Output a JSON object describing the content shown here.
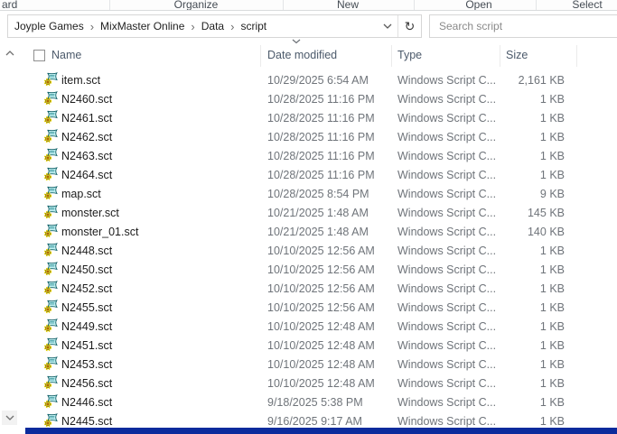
{
  "ribbon": {
    "groups": [
      {
        "label": "ard"
      },
      {
        "label": "Organize"
      },
      {
        "label": "New"
      },
      {
        "label": "Open"
      },
      {
        "label": "Select"
      }
    ]
  },
  "address_bar": {
    "breadcrumb": [
      "Joyple Games",
      "MixMaster Online",
      "Data",
      "script"
    ],
    "separator": "›",
    "dropdown_icon": "chevron-down",
    "refresh_icon": "refresh",
    "refresh_glyph": "↻"
  },
  "search": {
    "placeholder": "Search script"
  },
  "file_list": {
    "columns": {
      "name": "Name",
      "date_modified": "Date modified",
      "type": "Type",
      "size": "Size"
    },
    "sort": {
      "column": "Date modified",
      "direction": "descending"
    },
    "type_label": "Windows Script C...",
    "rows": [
      {
        "name": "item.sct",
        "date_modified": "10/29/2025 6:54 AM",
        "type": "Windows Script C...",
        "size": "2,161 KB"
      },
      {
        "name": "N2460.sct",
        "date_modified": "10/28/2025 11:16 PM",
        "type": "Windows Script C...",
        "size": "1 KB"
      },
      {
        "name": "N2461.sct",
        "date_modified": "10/28/2025 11:16 PM",
        "type": "Windows Script C...",
        "size": "1 KB"
      },
      {
        "name": "N2462.sct",
        "date_modified": "10/28/2025 11:16 PM",
        "type": "Windows Script C...",
        "size": "1 KB"
      },
      {
        "name": "N2463.sct",
        "date_modified": "10/28/2025 11:16 PM",
        "type": "Windows Script C...",
        "size": "1 KB"
      },
      {
        "name": "N2464.sct",
        "date_modified": "10/28/2025 11:16 PM",
        "type": "Windows Script C...",
        "size": "1 KB"
      },
      {
        "name": "map.sct",
        "date_modified": "10/28/2025 8:54 PM",
        "type": "Windows Script C...",
        "size": "9 KB"
      },
      {
        "name": "monster.sct",
        "date_modified": "10/21/2025 1:48 AM",
        "type": "Windows Script C...",
        "size": "145 KB"
      },
      {
        "name": "monster_01.sct",
        "date_modified": "10/21/2025 1:48 AM",
        "type": "Windows Script C...",
        "size": "140 KB"
      },
      {
        "name": "N2448.sct",
        "date_modified": "10/10/2025 12:56 AM",
        "type": "Windows Script C...",
        "size": "1 KB"
      },
      {
        "name": "N2450.sct",
        "date_modified": "10/10/2025 12:56 AM",
        "type": "Windows Script C...",
        "size": "1 KB"
      },
      {
        "name": "N2452.sct",
        "date_modified": "10/10/2025 12:56 AM",
        "type": "Windows Script C...",
        "size": "1 KB"
      },
      {
        "name": "N2455.sct",
        "date_modified": "10/10/2025 12:56 AM",
        "type": "Windows Script C...",
        "size": "1 KB"
      },
      {
        "name": "N2449.sct",
        "date_modified": "10/10/2025 12:48 AM",
        "type": "Windows Script C...",
        "size": "1 KB"
      },
      {
        "name": "N2451.sct",
        "date_modified": "10/10/2025 12:48 AM",
        "type": "Windows Script C...",
        "size": "1 KB"
      },
      {
        "name": "N2453.sct",
        "date_modified": "10/10/2025 12:48 AM",
        "type": "Windows Script C...",
        "size": "1 KB"
      },
      {
        "name": "N2456.sct",
        "date_modified": "10/10/2025 12:48 AM",
        "type": "Windows Script C...",
        "size": "1 KB"
      },
      {
        "name": "N2446.sct",
        "date_modified": "9/18/2025 5:38 PM",
        "type": "Windows Script C...",
        "size": "1 KB"
      },
      {
        "name": "N2445.sct",
        "date_modified": "9/16/2025 9:17 AM",
        "type": "Windows Script C...",
        "size": "1 KB"
      }
    ]
  },
  "icons": {
    "file_icon": "windows-script-component-icon",
    "scroll_up": "chevron-up-icon",
    "scroll_down": "chevron-down-icon"
  },
  "colors": {
    "header_text": "#4c5a6b",
    "file_name_text": "#1c1c1c",
    "secondary_text": "#6f747a",
    "border": "#d6d6d6",
    "bottom_strip": "#0b2b9c",
    "icon_gear_yellow": "#ffef3e",
    "icon_page_cyan": "#c2f2f4"
  }
}
